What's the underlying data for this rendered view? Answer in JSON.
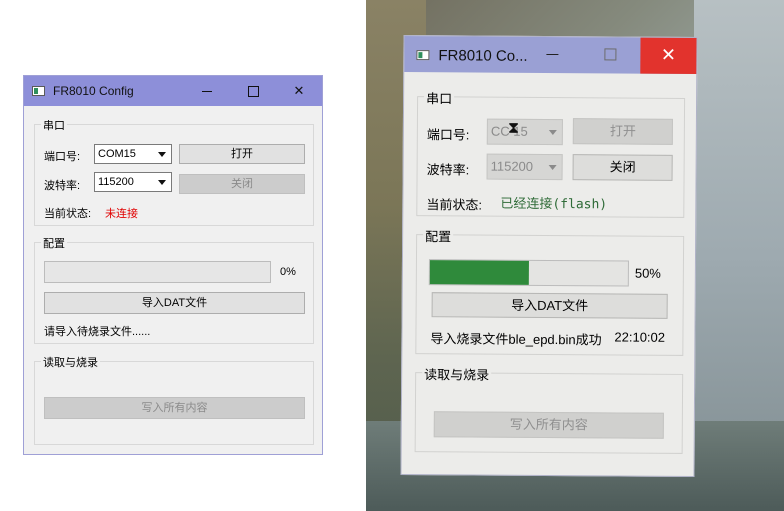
{
  "left_window": {
    "title": "FR8010 Config",
    "controls": {
      "minimize": "—",
      "maximize": "",
      "close": "✕"
    },
    "serial_group": {
      "label": "串口",
      "port_label": "端口号:",
      "port_value": "COM15",
      "open_button": "打开",
      "baud_label": "波特率:",
      "baud_value": "115200",
      "close_button": "关闭",
      "status_label": "当前状态:",
      "status_value": "未连接",
      "status_color": "#e00000"
    },
    "config_group": {
      "label": "配置",
      "progress_percent": 0,
      "progress_text": "0%",
      "import_button": "导入DAT文件",
      "hint": "请导入待烧录文件......"
    },
    "burn_group": {
      "label": "读取与烧录",
      "write_button": "写入所有内容"
    }
  },
  "right_window": {
    "title": "FR8010 Co...",
    "controls": {
      "close": "✕"
    },
    "serial_group": {
      "label": "串口",
      "port_label": "端口号:",
      "port_value": "CC 15",
      "open_button": "打开",
      "baud_label": "波特率:",
      "baud_value": "115200",
      "close_button": "关闭",
      "status_label": "当前状态:",
      "status_value": "已经连接(flash)",
      "status_color": "#2f6b38"
    },
    "config_group": {
      "label": "配置",
      "progress_percent": 50,
      "progress_text": "50%",
      "progress_color": "#2f8a3b",
      "import_button": "导入DAT文件",
      "result": "导入烧录文件ble_epd.bin成功",
      "time": "22:10:02"
    },
    "burn_group": {
      "label": "读取与烧录",
      "write_button": "写入所有内容"
    }
  }
}
